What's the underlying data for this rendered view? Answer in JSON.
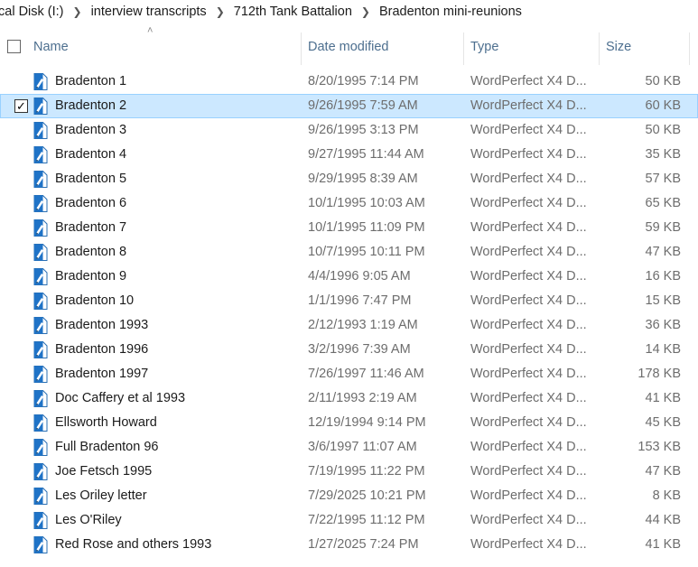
{
  "breadcrumb": [
    "cal Disk (I:)",
    "interview transcripts",
    "712th Tank Battalion",
    "Bradenton mini-reunions"
  ],
  "columns": {
    "name": "Name",
    "date": "Date modified",
    "type": "Type",
    "size": "Size"
  },
  "selected_index": 1,
  "files": [
    {
      "name": "Bradenton 1",
      "date": "8/20/1995 7:14 PM",
      "type": "WordPerfect X4 D...",
      "size": "50 KB"
    },
    {
      "name": "Bradenton 2",
      "date": "9/26/1995 7:59 AM",
      "type": "WordPerfect X4 D...",
      "size": "60 KB"
    },
    {
      "name": "Bradenton 3",
      "date": "9/26/1995 3:13 PM",
      "type": "WordPerfect X4 D...",
      "size": "50 KB"
    },
    {
      "name": "Bradenton 4",
      "date": "9/27/1995 11:44 AM",
      "type": "WordPerfect X4 D...",
      "size": "35 KB"
    },
    {
      "name": "Bradenton 5",
      "date": "9/29/1995 8:39 AM",
      "type": "WordPerfect X4 D...",
      "size": "57 KB"
    },
    {
      "name": "Bradenton 6",
      "date": "10/1/1995 10:03 AM",
      "type": "WordPerfect X4 D...",
      "size": "65 KB"
    },
    {
      "name": "Bradenton 7",
      "date": "10/1/1995 11:09 PM",
      "type": "WordPerfect X4 D...",
      "size": "59 KB"
    },
    {
      "name": "Bradenton 8",
      "date": "10/7/1995 10:11 PM",
      "type": "WordPerfect X4 D...",
      "size": "47 KB"
    },
    {
      "name": "Bradenton 9",
      "date": "4/4/1996 9:05 AM",
      "type": "WordPerfect X4 D...",
      "size": "16 KB"
    },
    {
      "name": "Bradenton 10",
      "date": "1/1/1996 7:47 PM",
      "type": "WordPerfect X4 D...",
      "size": "15 KB"
    },
    {
      "name": "Bradenton 1993",
      "date": "2/12/1993 1:19 AM",
      "type": "WordPerfect X4 D...",
      "size": "36 KB"
    },
    {
      "name": "Bradenton 1996",
      "date": "3/2/1996 7:39 AM",
      "type": "WordPerfect X4 D...",
      "size": "14 KB"
    },
    {
      "name": "Bradenton 1997",
      "date": "7/26/1997 11:46 AM",
      "type": "WordPerfect X4 D...",
      "size": "178 KB"
    },
    {
      "name": "Doc Caffery et al 1993",
      "date": "2/11/1993 2:19 AM",
      "type": "WordPerfect X4 D...",
      "size": "41 KB"
    },
    {
      "name": "Ellsworth Howard",
      "date": "12/19/1994 9:14 PM",
      "type": "WordPerfect X4 D...",
      "size": "45 KB"
    },
    {
      "name": "Full Bradenton 96",
      "date": "3/6/1997 11:07 AM",
      "type": "WordPerfect X4 D...",
      "size": "153 KB"
    },
    {
      "name": "Joe Fetsch 1995",
      "date": "7/19/1995 11:22 PM",
      "type": "WordPerfect X4 D...",
      "size": "47 KB"
    },
    {
      "name": "Les Oriley letter",
      "date": "7/29/2025 10:21 PM",
      "type": "WordPerfect X4 D...",
      "size": "8 KB"
    },
    {
      "name": "Les O'Riley",
      "date": "7/22/1995 11:12 PM",
      "type": "WordPerfect X4 D...",
      "size": "44 KB"
    },
    {
      "name": "Red Rose and others 1993",
      "date": "1/27/2025 7:24 PM",
      "type": "WordPerfect X4 D...",
      "size": "41 KB"
    }
  ],
  "icons": {
    "file": "wordperfect-document-icon",
    "sort": "sort-up-chevron-icon",
    "separator": "chevron-right-icon"
  },
  "colors": {
    "selection": "#cce8ff",
    "selection_border": "#99d1ff",
    "header_text": "#4d6f8f",
    "muted_text": "#6d6d6d"
  }
}
